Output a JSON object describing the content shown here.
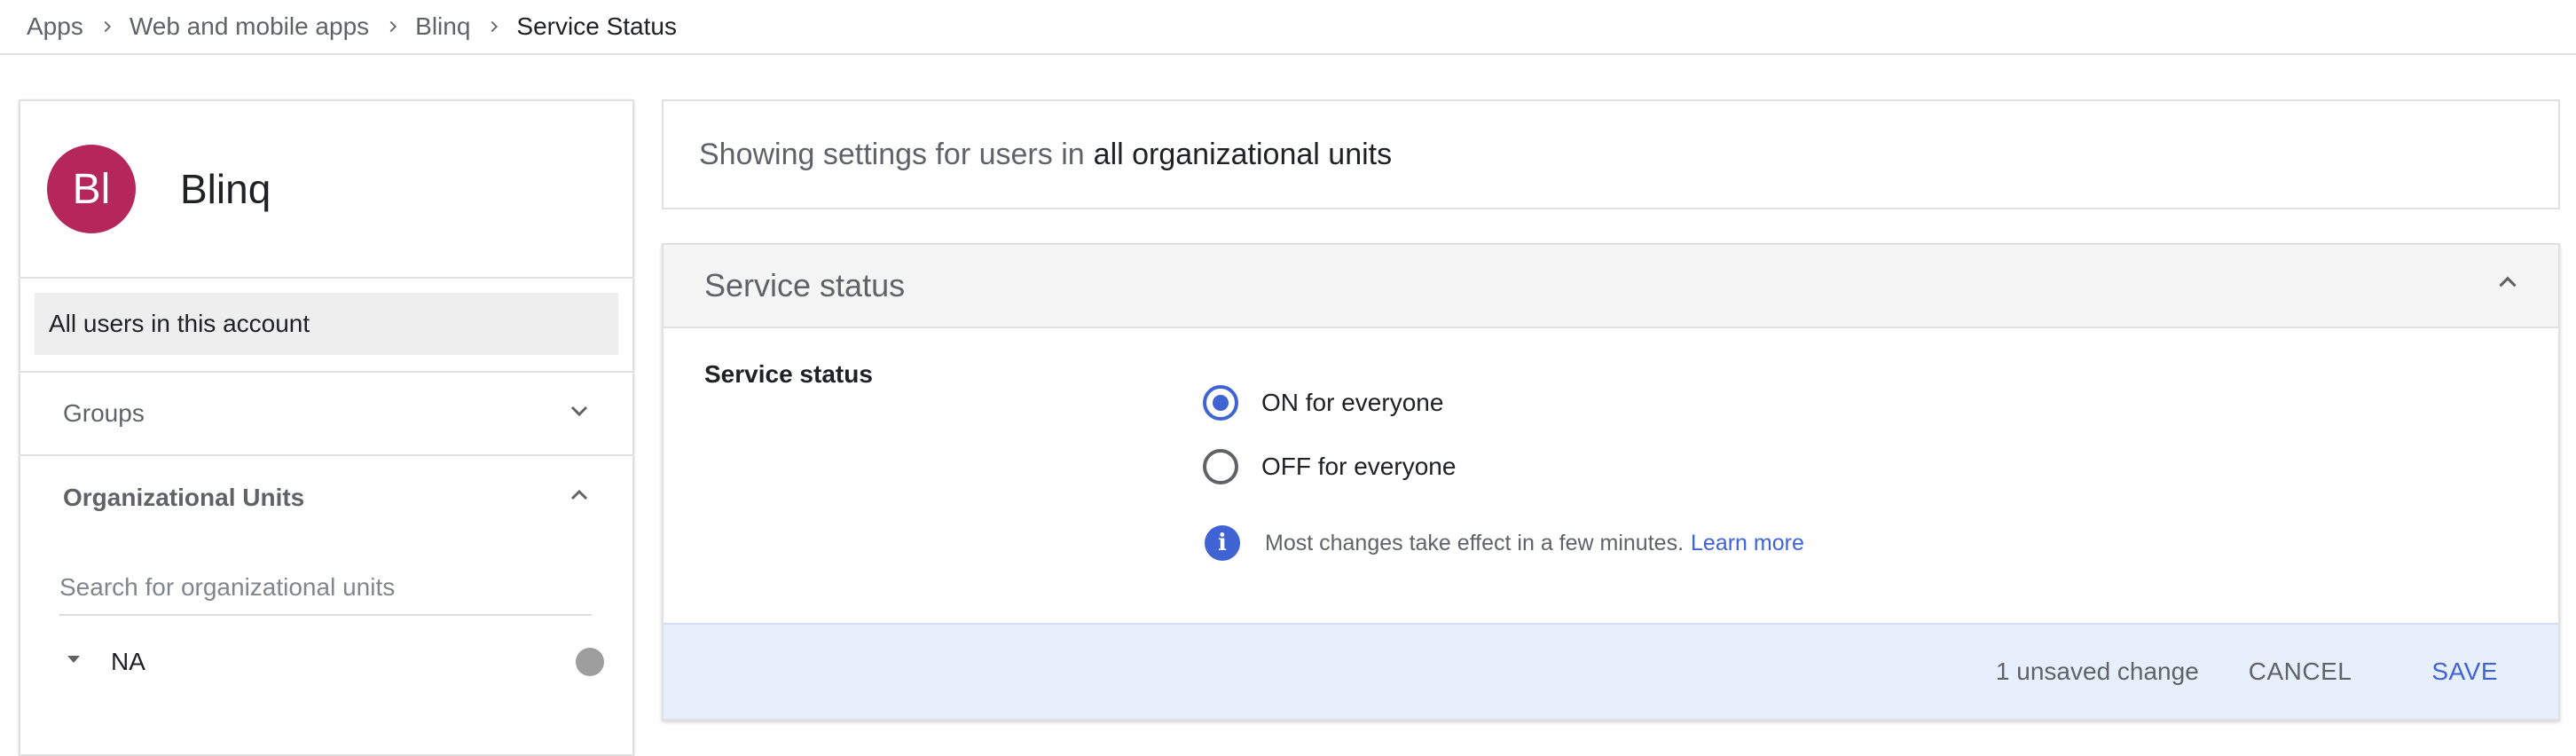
{
  "breadcrumb": {
    "items": [
      "Apps",
      "Web and mobile apps",
      "Blinq",
      "Service Status"
    ]
  },
  "app": {
    "avatar_initials": "Bl",
    "avatar_color": "#b5265a",
    "name": "Blinq"
  },
  "sidebar": {
    "all_users_label": "All users in this account",
    "groups_label": "Groups",
    "org_units_label": "Organizational Units",
    "search_placeholder": "Search for organizational units",
    "org_unit_node": "NA"
  },
  "banner": {
    "prefix": "Showing settings for users in",
    "scope": "all organizational units"
  },
  "panel": {
    "title": "Service status",
    "setting_label": "Service status",
    "options": [
      {
        "label": "ON for everyone",
        "selected": true
      },
      {
        "label": "OFF for everyone",
        "selected": false
      }
    ],
    "info_text": "Most changes take effect in a few minutes.",
    "learn_more": "Learn more",
    "unsaved_text": "1 unsaved change",
    "cancel_label": "CANCEL",
    "save_label": "SAVE",
    "accent_color": "#3f63d3",
    "footer_bg": "#e8effc"
  }
}
